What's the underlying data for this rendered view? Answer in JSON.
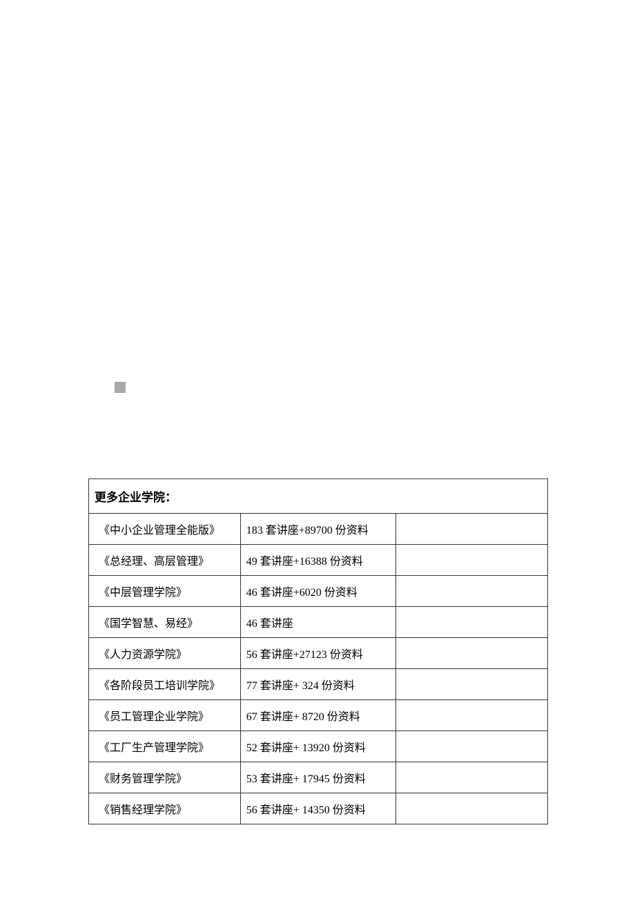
{
  "header": {
    "title": "更多企业学院："
  },
  "rows": [
    {
      "name": "《中小企业管理全能版》",
      "content": "183 套讲座+89700 份资料"
    },
    {
      "name": "《总经理、高层管理》",
      "content": "49 套讲座+16388 份资料"
    },
    {
      "name": "《中层管理学院》",
      "content": "46 套讲座+6020 份资料"
    },
    {
      "name": "《国学智慧、易经》",
      "content": "46 套讲座"
    },
    {
      "name": "《人力资源学院》",
      "content": "56 套讲座+27123 份资料"
    },
    {
      "name": "《各阶段员工培训学院》",
      "content": "77 套讲座+ 324 份资料"
    },
    {
      "name": "《员工管理企业学院》",
      "content": "67 套讲座+ 8720 份资料"
    },
    {
      "name": "《工厂生产管理学院》",
      "content": "52 套讲座+ 13920 份资料"
    },
    {
      "name": "《财务管理学院》",
      "content": "53 套讲座+ 17945 份资料"
    },
    {
      "name": "《销售经理学院》",
      "content": "56 套讲座+ 14350 份资料"
    }
  ]
}
